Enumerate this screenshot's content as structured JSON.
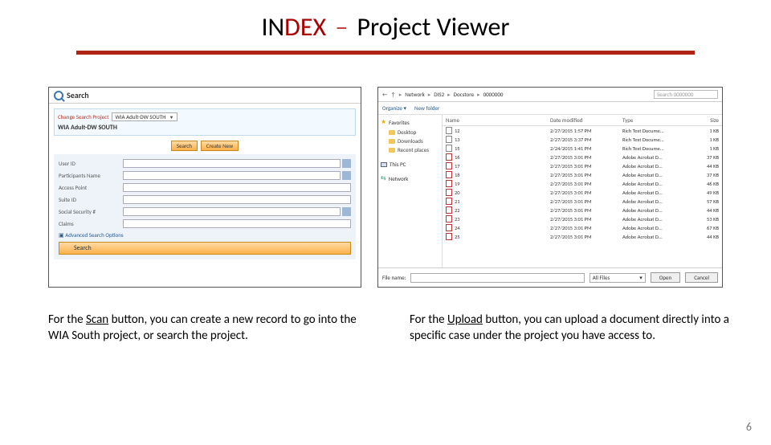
{
  "title": {
    "part1": "IN",
    "part2": "DEX",
    "dash": "–",
    "rest": "Project Viewer"
  },
  "left_panel": {
    "search_header": "Search",
    "change_label": "Change Search Project",
    "project_select": "WIA Adult-DW SOUTH",
    "project_heading": "WIA Adult-DW SOUTH",
    "btn_search": "Search",
    "btn_create": "Create New",
    "fields": {
      "user_id": "User ID",
      "participants_name": "Participants Name",
      "access_point": "Access Point",
      "suite_id": "Suite ID",
      "ssn": "Social Security #",
      "claims": "Claims"
    },
    "advanced": "Advanced Search Options",
    "btn_search_big": "Search"
  },
  "right_panel": {
    "breadcrumb": [
      "Network",
      "DIS2",
      "Docstore",
      "0000000"
    ],
    "search_placeholder": "Search 0000000",
    "toolbar": {
      "organize": "Organize ▾",
      "newfolder": "New folder"
    },
    "sidebar": {
      "favorites": "Favorites",
      "desktop": "Desktop",
      "downloads": "Downloads",
      "recent": "Recent places",
      "thispc": "This PC",
      "network": "Network"
    },
    "columns": {
      "name": "Name",
      "date": "Date modified",
      "type": "Type",
      "size": "Size"
    },
    "files": [
      {
        "name": "12",
        "date": "2/27/2015 1:57 PM",
        "type": "Rich Text Docume...",
        "size": "1 KB",
        "icon": "txt"
      },
      {
        "name": "13",
        "date": "2/27/2015 3:37 PM",
        "type": "Rich Text Docume...",
        "size": "1 KB",
        "icon": "txt"
      },
      {
        "name": "15",
        "date": "2/24/2015 1:41 PM",
        "type": "Rich Text Docume...",
        "size": "1 KB",
        "icon": "txt"
      },
      {
        "name": "16",
        "date": "2/27/2015 3:01 PM",
        "type": "Adobe Acrobat D...",
        "size": "37 KB",
        "icon": "pdf"
      },
      {
        "name": "17",
        "date": "2/27/2015 3:01 PM",
        "type": "Adobe Acrobat D...",
        "size": "44 KB",
        "icon": "pdf"
      },
      {
        "name": "18",
        "date": "2/27/2015 3:01 PM",
        "type": "Adobe Acrobat D...",
        "size": "37 KB",
        "icon": "pdf"
      },
      {
        "name": "19",
        "date": "2/27/2015 3:01 PM",
        "type": "Adobe Acrobat D...",
        "size": "46 KB",
        "icon": "pdf"
      },
      {
        "name": "20",
        "date": "2/27/2015 3:01 PM",
        "type": "Adobe Acrobat D...",
        "size": "49 KB",
        "icon": "pdf"
      },
      {
        "name": "21",
        "date": "2/27/2015 3:01 PM",
        "type": "Adobe Acrobat D...",
        "size": "57 KB",
        "icon": "pdf"
      },
      {
        "name": "22",
        "date": "2/27/2015 3:01 PM",
        "type": "Adobe Acrobat D...",
        "size": "44 KB",
        "icon": "pdf"
      },
      {
        "name": "23",
        "date": "2/27/2015 3:01 PM",
        "type": "Adobe Acrobat D...",
        "size": "53 KB",
        "icon": "pdf"
      },
      {
        "name": "24",
        "date": "2/27/2015 3:01 PM",
        "type": "Adobe Acrobat D...",
        "size": "67 KB",
        "icon": "pdf"
      },
      {
        "name": "25",
        "date": "2/27/2015 3:01 PM",
        "type": "Adobe Acrobat D...",
        "size": "44 KB",
        "icon": "pdf"
      }
    ],
    "filename_label": "File name:",
    "filter": "All Files",
    "btn_open": "Open",
    "btn_cancel": "Cancel"
  },
  "captions": {
    "left_pre": "For the ",
    "left_scan": "Scan",
    "left_post": " button, you can create a new record to go into the WIA South project, or search the project.",
    "right_pre": "For the ",
    "right_upload": "Upload",
    "right_post": " button, you can upload a document directly into a specific case under the project you have access to."
  },
  "page_number": "6"
}
